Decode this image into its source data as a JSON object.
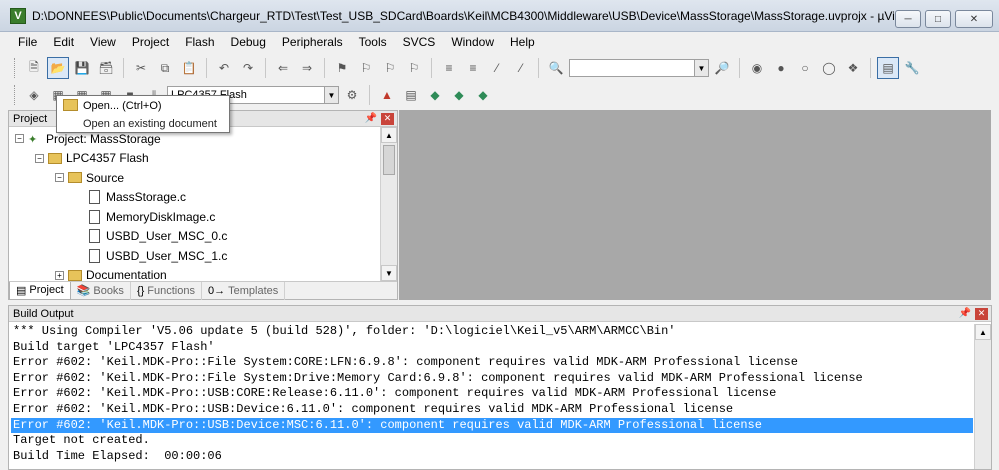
{
  "window": {
    "title": "D:\\DONNEES\\Public\\Documents\\Chargeur_RTD\\Test\\Test_USB_SDCard\\Boards\\Keil\\MCB4300\\Middleware\\USB\\Device\\MassStorage\\MassStorage.uvprojx - µVision",
    "app_icon_letter": "V"
  },
  "menu": [
    "File",
    "Edit",
    "View",
    "Project",
    "Flash",
    "Debug",
    "Peripherals",
    "Tools",
    "SVCS",
    "Window",
    "Help"
  ],
  "toolbar2": {
    "target": "LPC4357 Flash"
  },
  "tooltip": {
    "title": "Open... (Ctrl+O)",
    "description": "Open an existing document"
  },
  "project_pane": {
    "header": "Project",
    "tree": [
      {
        "label": "Project: MassStorage",
        "level": 0
      },
      {
        "label": "LPC4357 Flash",
        "level": 1
      },
      {
        "label": "Source",
        "level": 2
      },
      {
        "label": "MassStorage.c",
        "level": 3
      },
      {
        "label": "MemoryDiskImage.c",
        "level": 3
      },
      {
        "label": "USBD_User_MSC_0.c",
        "level": 3
      },
      {
        "label": "USBD_User_MSC_1.c",
        "level": 3
      },
      {
        "label": "Documentation",
        "level": 2
      }
    ],
    "tabs": [
      "Project",
      "Books",
      "Functions",
      "Templates"
    ]
  },
  "build_output": {
    "header": "Build Output",
    "lines": [
      "*** Using Compiler 'V5.06 update 5 (build 528)', folder: 'D:\\logiciel\\Keil_v5\\ARM\\ARMCC\\Bin'",
      "Build target 'LPC4357 Flash'",
      "Error #602: 'Keil.MDK-Pro::File System:CORE:LFN:6.9.8': component requires valid MDK-ARM Professional license",
      "Error #602: 'Keil.MDK-Pro::File System:Drive:Memory Card:6.9.8': component requires valid MDK-ARM Professional license",
      "Error #602: 'Keil.MDK-Pro::USB:CORE:Release:6.11.0': component requires valid MDK-ARM Professional license",
      "Error #602: 'Keil.MDK-Pro::USB:Device:6.11.0': component requires valid MDK-ARM Professional license",
      "Error #602: 'Keil.MDK-Pro::USB:Device:MSC:6.11.0': component requires valid MDK-ARM Professional license",
      "Target not created.",
      "Build Time Elapsed:  00:00:06"
    ],
    "selected_index": 6
  },
  "colors": {
    "selection": "#3399ff",
    "editor_bg": "#a8a8a8"
  }
}
